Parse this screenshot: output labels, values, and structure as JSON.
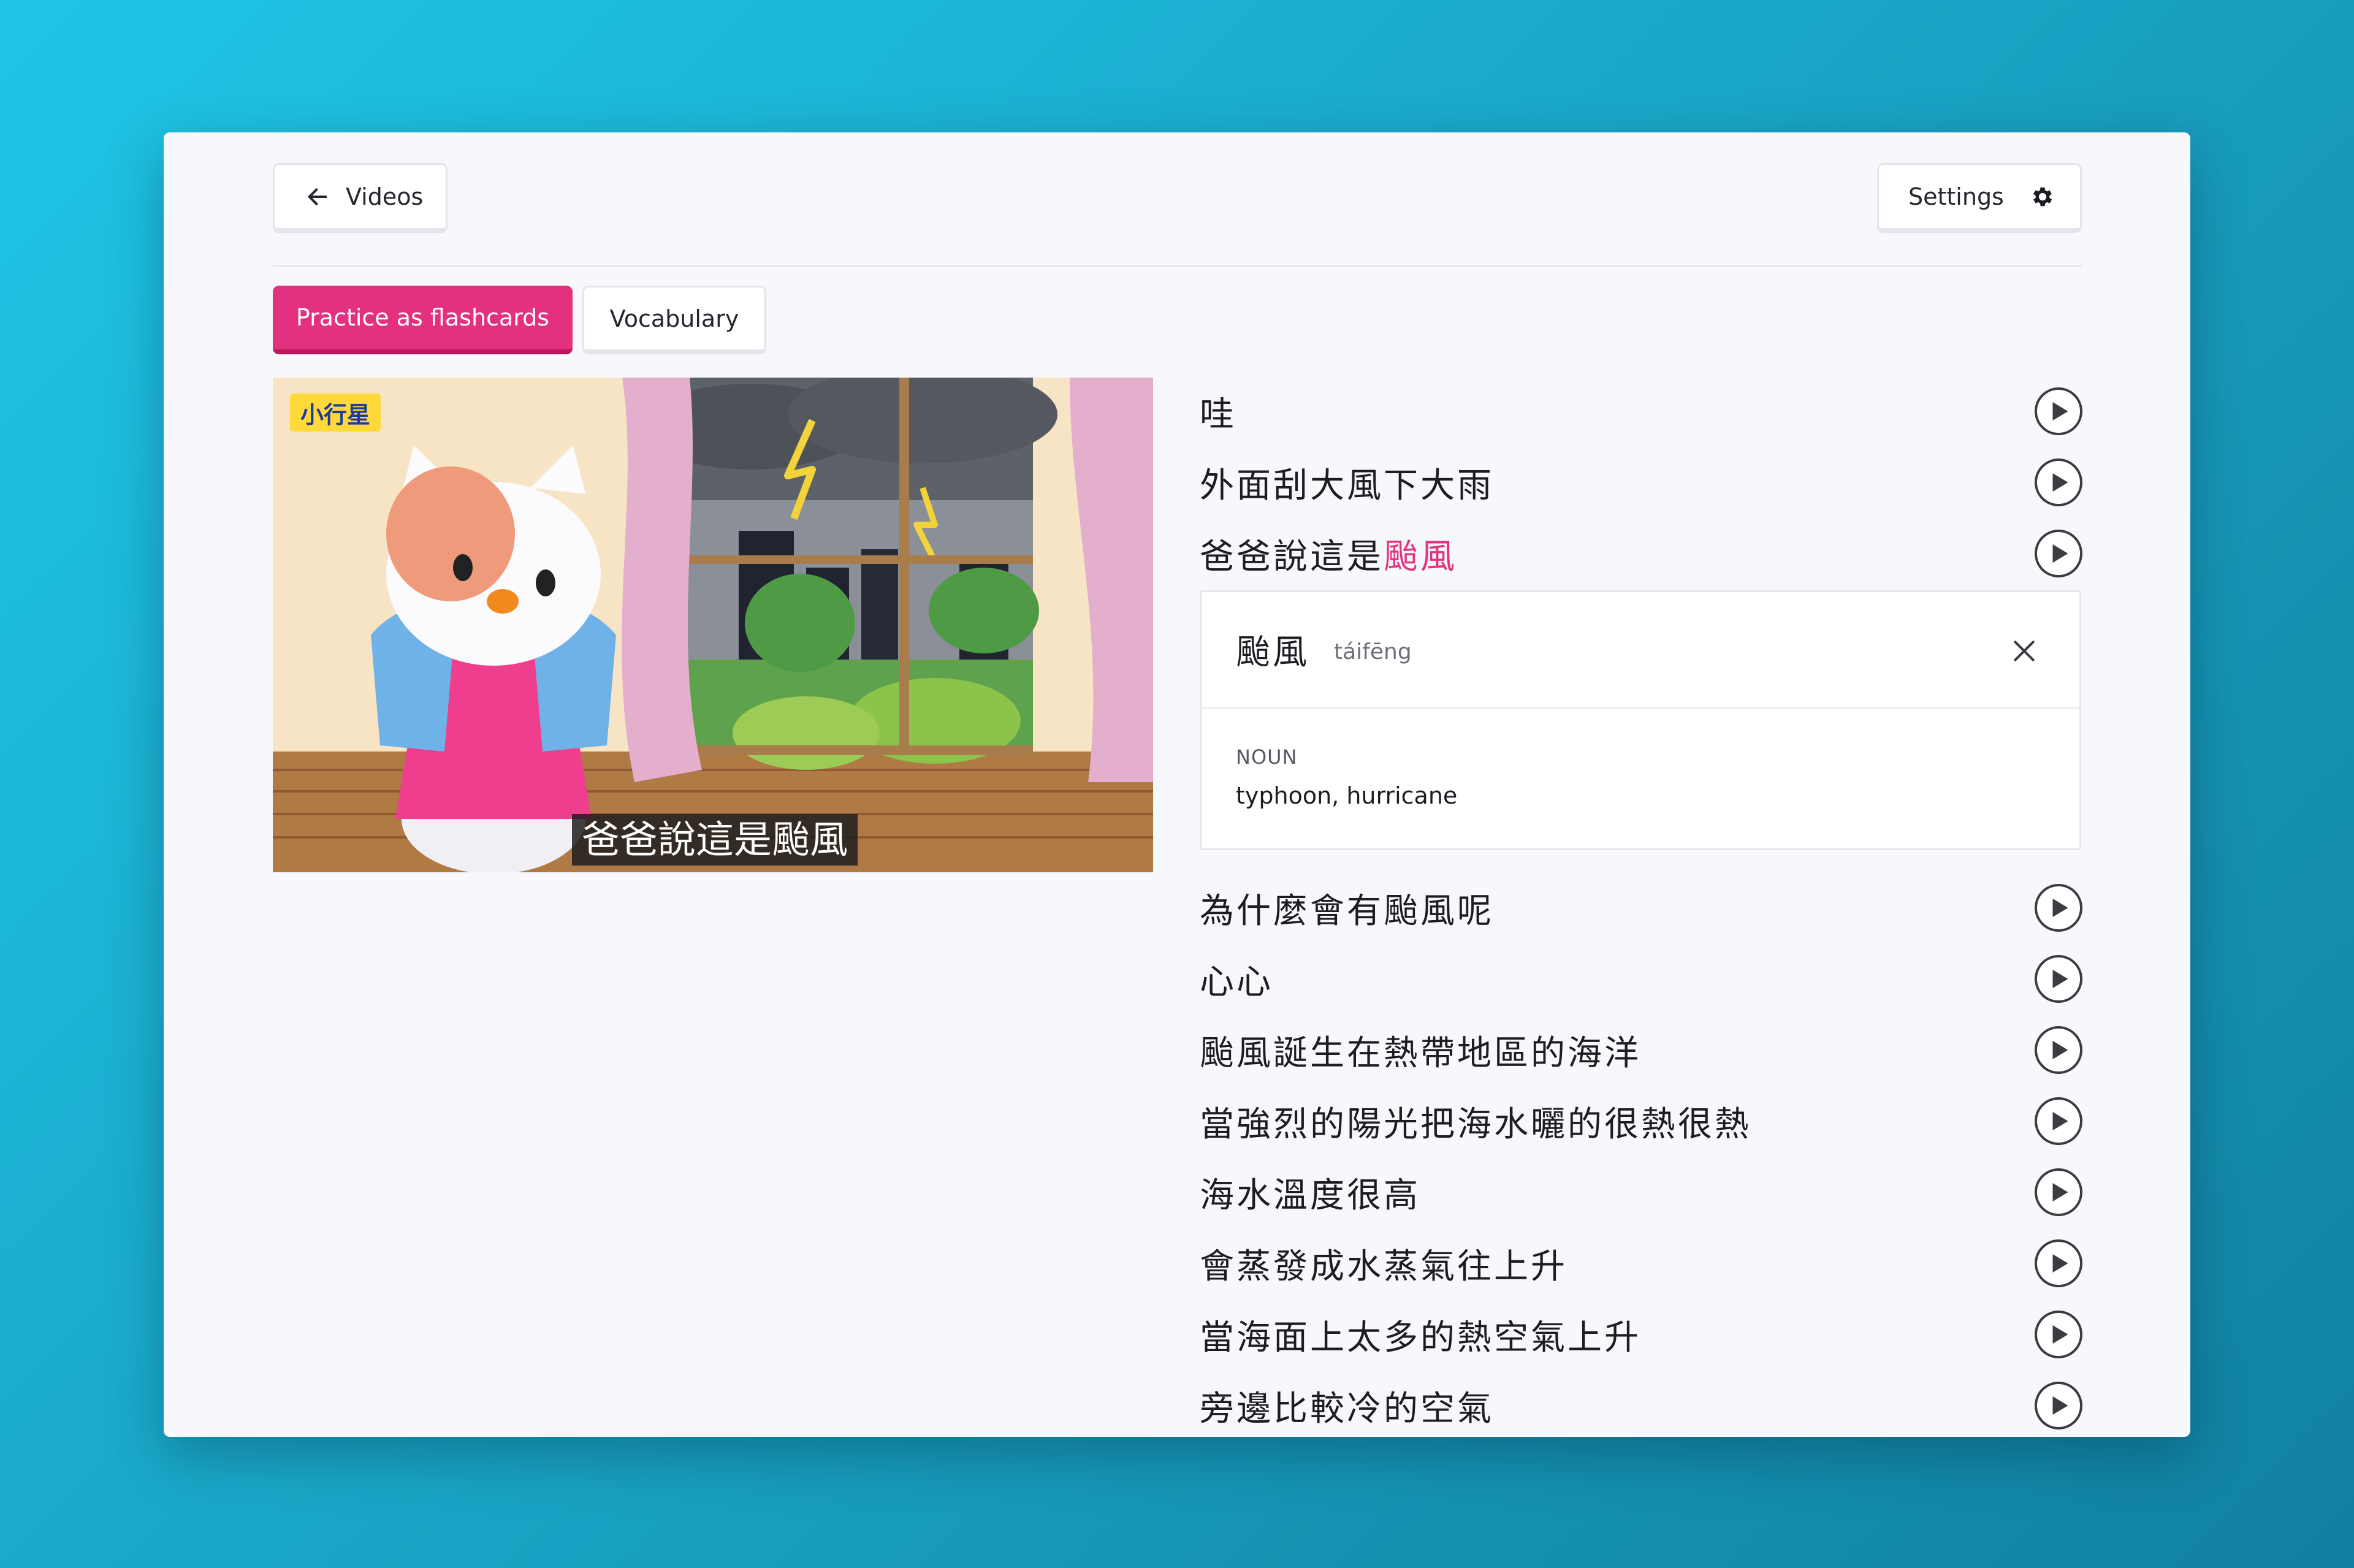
{
  "nav": {
    "back_label": "Videos",
    "back_icon": "arrow-left-icon",
    "settings_label": "Settings",
    "settings_icon": "gear-icon"
  },
  "tabs": {
    "flashcards_label": "Practice as flashcards",
    "vocabulary_label": "Vocabulary"
  },
  "video": {
    "subtitle": "爸爸說這是颱風",
    "channel_logo": "小行星"
  },
  "colors": {
    "accent": "#e3307f",
    "background_gradient_start": "#1fc6e6",
    "background_gradient_end": "#1180a0"
  },
  "transcript": {
    "lines": [
      {
        "text": "哇"
      },
      {
        "text": "外面刮大風下大雨"
      },
      {
        "text_before": "爸爸說這是",
        "highlight": "颱風"
      },
      {
        "text": "為什麼會有颱風呢"
      },
      {
        "text": "心心"
      },
      {
        "text": "颱風誕生在熱帶地區的海洋"
      },
      {
        "text": "當強烈的陽光把海水曬的很熱很熱"
      },
      {
        "text": "海水溫度很高"
      },
      {
        "text": "會蒸發成水蒸氣往上升"
      },
      {
        "text": "當海面上太多的熱空氣上升"
      },
      {
        "text": "旁邊比較冷的空氣"
      }
    ]
  },
  "word_card": {
    "word": "颱風",
    "pinyin": "táifēng",
    "part_of_speech": "NOUN",
    "definition": "typhoon, hurricane"
  }
}
